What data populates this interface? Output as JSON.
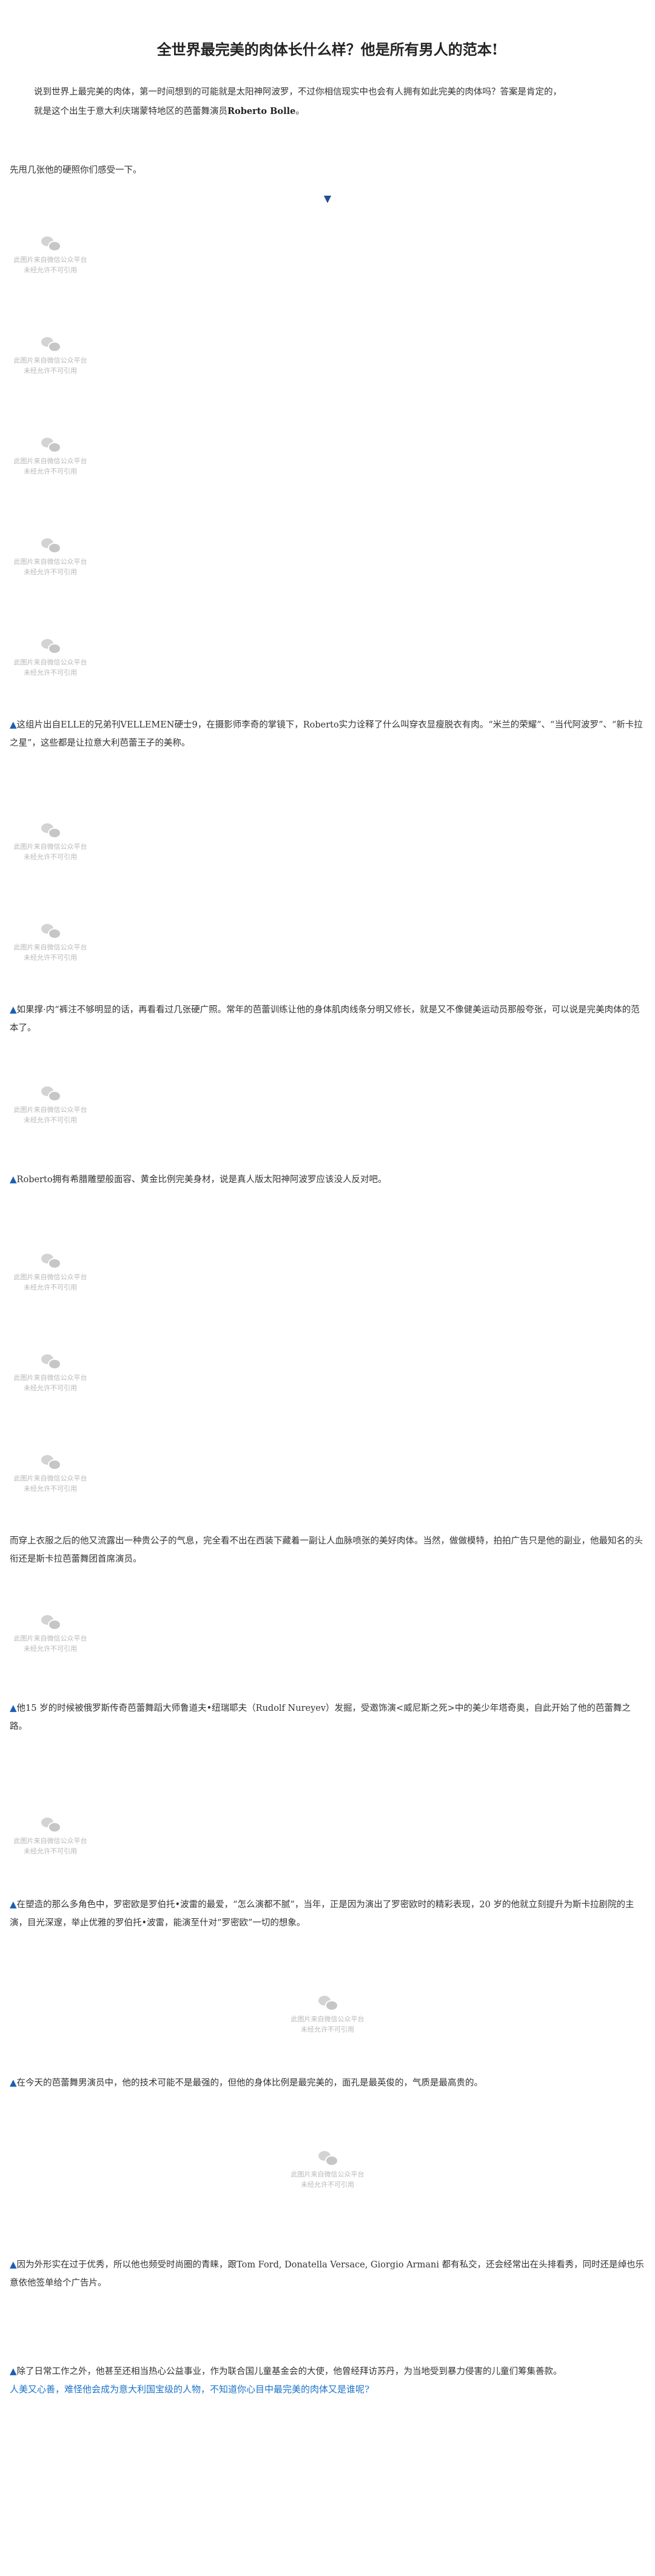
{
  "article": {
    "title": "全世界最完美的肉体长什么样？他是所有男人的范本!",
    "intro_line1": "说到世界上最完美的肉体，第一时间想到的可能就是太阳神阿波罗，不过你相信现实中也会有人拥有如此完美的肉体吗？答案是肯定的，",
    "intro_line2_pre": "就是这个出生于意大利庆瑞蒙特地区的芭蕾舞演员",
    "intro_line2_name": "Roberto Bolle",
    "intro_line2_post": "。",
    "lead": "先甩几张他的硬照你们感受一下。",
    "arrow": "▼"
  },
  "placeholder": {
    "line1": "此图片来自微信公众平台",
    "line2": "未经允许不可引用"
  },
  "paragraphs": [
    {
      "tri": "▲",
      "text": "这组片出自ELLE的兄弟刊VELLEMEN硬士9，在摄影师李奇的掌镜下，Roberto实力诠释了什么叫穿衣显瘦脱衣有肉。“米兰的荣耀”、“当代阿波罗”、“新卡拉之星”，这些都是让拉意大利芭蕾王子的美称。"
    },
    {
      "tri": "▲",
      "text": "如果撑·内“裤注不够明显的话，再看看过几张硬广照。常年的芭蕾训练让他的身体肌肉线条分明又修长，就是又不像健美运动员那般夸张，可以说是完美肉体的范本了。"
    },
    {
      "tri": "▲",
      "text": "Roberto拥有希腊雕塑般面容、黄金比例完美身材，说是真人版太阳神阿波罗应该没人反对吧。"
    },
    {
      "tri": "",
      "text": "而穿上衣服之后的他又流露出一种贵公子的气息，完全看不出在西装下藏着一副让人血脉喷张的美好肉体。当然，做做模特，拍拍广告只是他的副业，他最知名的头衔还是斯卡拉芭蕾舞团首席演员。"
    },
    {
      "tri": "▲",
      "text": "他15 岁的时候被俄罗斯传奇芭蕾舞蹈大师鲁道夫•纽瑞耶夫（Rudolf Nureyev）发掘，受邀饰演<威尼斯之死>中的美少年塔奇奥，自此开始了他的芭蕾舞之路。"
    },
    {
      "tri": "▲",
      "text": "在塑造的那么多角色中，罗密欧是罗伯托•波雷的最爱，“怎么演都不腻”，当年，正是因为演出了罗密欧时的精彩表现，20 岁的他就立刻提升为斯卡拉剧院的主演，目光深邃，举止优雅的罗伯托•波雷，能演至什对“罗密欧”一切的想象。"
    },
    {
      "tri": "▲",
      "text": "在今天的芭蕾舞男演员中，他的技术可能不是最强的，但他的身体比例是最完美的，面孔是最英俊的，气质是最高贵的。"
    },
    {
      "tri": "▲",
      "text": "因为外形实在过于优秀，所以他也频受时尚圈的青睐，跟Tom Ford, Donatella Versace, Giorgio Armani 都有私交，还会经常出在头排看秀，同时还是绰也乐意依他签单给个广告片。"
    },
    {
      "tri": "▲",
      "text": "除了日常工作之外，他甚至还相当热心公益事业，作为联合国儿童基金会的大使，他曾经拜访苏丹，为当地受到暴力侵害的儿童们筹集善款。"
    }
  ],
  "footer_link": "人美又心善，难怪他会成为意大利国宝级的人物，不知道你心目中最完美的肉体又是谁呢?"
}
